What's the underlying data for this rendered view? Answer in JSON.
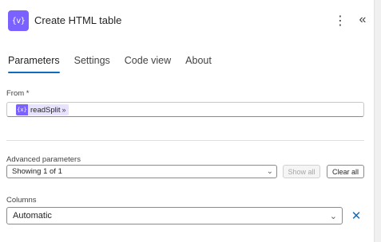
{
  "header": {
    "action_icon_glyph": "{v}",
    "title": "Create HTML table",
    "more_icon": "more-vertical-icon",
    "collapse_icon": "collapse-panel-icon"
  },
  "tabs": [
    {
      "label": "Parameters",
      "active": true
    },
    {
      "label": "Settings",
      "active": false
    },
    {
      "label": "Code view",
      "active": false
    },
    {
      "label": "About",
      "active": false
    }
  ],
  "from": {
    "label": "From *",
    "token": {
      "icon_glyph": "{x}",
      "label": "readSplit",
      "chevron": "»"
    }
  },
  "advanced": {
    "label": "Advanced parameters",
    "selected": "Showing 1 of 1",
    "show_all_label": "Show all",
    "clear_all_label": "Clear all"
  },
  "columns": {
    "label": "Columns",
    "selected": "Automatic"
  },
  "colors": {
    "accent": "#0f6cbd",
    "action_purple": "#7b61ff",
    "token_bg": "#e8e2ff"
  }
}
